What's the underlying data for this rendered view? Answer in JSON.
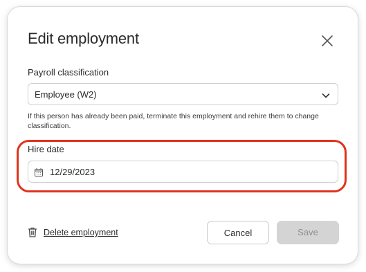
{
  "dialog": {
    "title": "Edit employment",
    "payroll_label": "Payroll classification",
    "payroll_value": "Employee (W2)",
    "help_text": "If this person has already been paid, terminate this employment and rehire them to change classification.",
    "hire_date_label": "Hire date",
    "hire_date_value": "12/29/2023",
    "delete_label": "Delete employment",
    "cancel_label": "Cancel",
    "save_label": "Save"
  },
  "icons": {
    "close": "close-icon",
    "chevron": "chevron-down-icon",
    "calendar": "calendar-icon",
    "trash": "trash-icon"
  },
  "colors": {
    "highlight": "#e0321b",
    "save_disabled_bg": "#d4d4d4",
    "text": "#2b2b2b"
  }
}
